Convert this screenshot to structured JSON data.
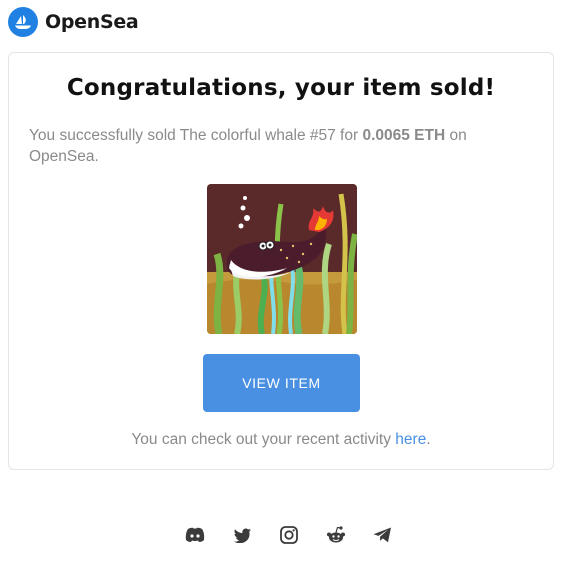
{
  "brand": {
    "name": "OpenSea",
    "logo_icon": "opensea-boat-icon",
    "logo_color": "#2081e2"
  },
  "card": {
    "title": "Congratulations, your item sold!",
    "message": {
      "prefix": "You successfully sold The colorful whale #57 for ",
      "price": "0.0065 ETH",
      "suffix": " on OpenSea."
    },
    "image_icon": "nft-whale-artwork",
    "view_button_label": "VIEW ITEM",
    "activity": {
      "text": "You can check out your recent activity ",
      "link_label": "here",
      "period": "."
    }
  },
  "colors": {
    "button": "#4a90e2",
    "link": "#4a90e2",
    "muted_text": "#8a8a8a"
  },
  "footer_socials": [
    {
      "icon": "discord-icon"
    },
    {
      "icon": "twitter-icon"
    },
    {
      "icon": "instagram-icon"
    },
    {
      "icon": "reddit-icon"
    },
    {
      "icon": "telegram-icon"
    }
  ]
}
